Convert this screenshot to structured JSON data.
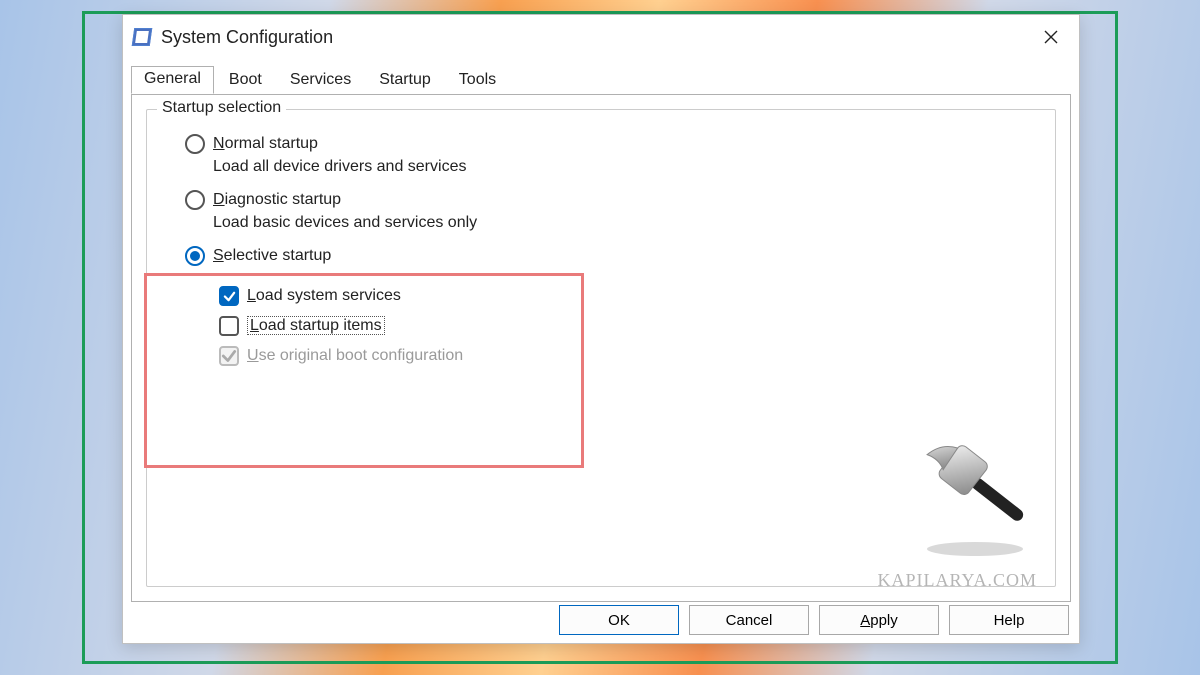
{
  "window": {
    "title": "System Configuration"
  },
  "tabs": [
    {
      "label": "General"
    },
    {
      "label": "Boot"
    },
    {
      "label": "Services"
    },
    {
      "label": "Startup"
    },
    {
      "label": "Tools"
    }
  ],
  "group": {
    "title": "Startup selection"
  },
  "options": {
    "normal": {
      "prefix": "N",
      "rest": "ormal startup",
      "desc": "Load all device drivers and services"
    },
    "diag": {
      "prefix": "D",
      "rest": "iagnostic startup",
      "desc": "Load basic devices and services only"
    },
    "selective": {
      "prefix": "S",
      "rest": "elective startup"
    }
  },
  "checks": {
    "services": {
      "prefix": "L",
      "rest": "oad system services"
    },
    "startup": {
      "prefix": "L",
      "rest": "oad startup items"
    },
    "bootcfg": {
      "prefix": "U",
      "rest": "se original boot configuration"
    }
  },
  "buttons": {
    "ok": "OK",
    "cancel": "Cancel",
    "apply_prefix": "A",
    "apply_rest": "pply",
    "help": "Help"
  },
  "watermark": "KAPILARYA.COM"
}
